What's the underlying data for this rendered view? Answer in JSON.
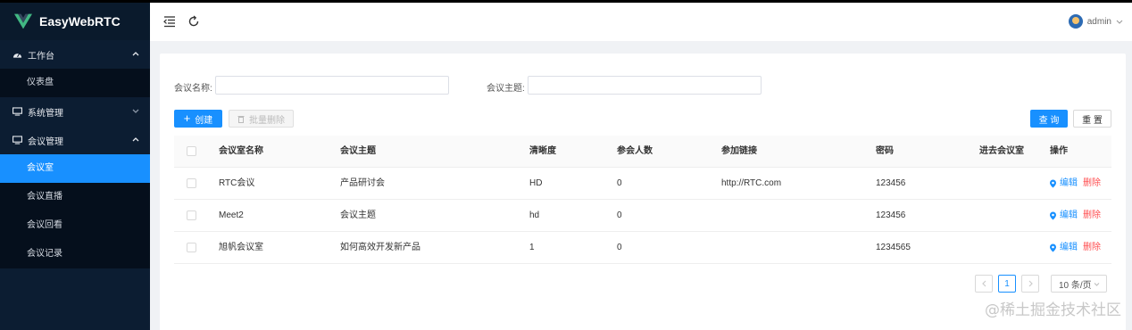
{
  "app": {
    "logo_text": "EasyWebRTC"
  },
  "sidebar": {
    "groups": [
      {
        "label": "工作台",
        "icon": "dashboard-icon",
        "expanded": true,
        "items": [
          {
            "label": "仪表盘"
          }
        ]
      },
      {
        "label": "系统管理",
        "icon": "monitor-icon",
        "expanded": false,
        "items": []
      },
      {
        "label": "会议管理",
        "icon": "monitor-icon",
        "expanded": true,
        "items": [
          {
            "label": "会议室",
            "active": true
          },
          {
            "label": "会议直播"
          },
          {
            "label": "会议回看"
          },
          {
            "label": "会议记录"
          }
        ]
      }
    ]
  },
  "header": {
    "user_name": "admin"
  },
  "filters": {
    "name_label": "会议名称:",
    "name_value": "",
    "topic_label": "会议主题:",
    "topic_value": ""
  },
  "toolbar": {
    "create_label": "创建",
    "batch_delete_label": "批量删除",
    "query_label": "查 询",
    "reset_label": "重 置"
  },
  "table": {
    "columns": [
      "会议室名称",
      "会议主题",
      "清晰度",
      "参会人数",
      "参加链接",
      "密码",
      "进去会议室",
      "操作"
    ],
    "rows": [
      {
        "name": "RTC会议",
        "topic": "产品研讨会",
        "clarity": "HD",
        "participants": "0",
        "link": "http://RTC.com",
        "password": "123456",
        "enter": ""
      },
      {
        "name": "Meet2",
        "topic": "会议主题",
        "clarity": "hd",
        "participants": "0",
        "link": "",
        "password": "123456",
        "enter": ""
      },
      {
        "name": "旭帆会议室",
        "topic": "如何高效开发新产品",
        "clarity": "1",
        "participants": "0",
        "link": "",
        "password": "1234565",
        "enter": ""
      }
    ],
    "edit_label": "编辑",
    "delete_label": "删除"
  },
  "pagination": {
    "current_page": "1",
    "page_size": "10 条/页"
  },
  "watermark": "@稀土掘金技术社区",
  "colors": {
    "sidebar_bg": "#0c1d32",
    "primary": "#1890ff",
    "danger": "#ff4d4f",
    "logo_green": "#41b883"
  }
}
